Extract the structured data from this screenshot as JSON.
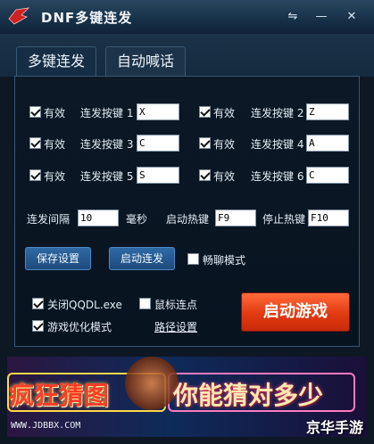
{
  "window": {
    "title": "DNF多键连发",
    "buttons": {
      "menu": "⇋",
      "minimize": "—",
      "close": "✕"
    }
  },
  "tabs": [
    {
      "label": "多键连发"
    },
    {
      "label": "自动喊话"
    }
  ],
  "keys": [
    {
      "enabled_label": "有效",
      "label": "连发按键 1",
      "value": "X"
    },
    {
      "enabled_label": "有效",
      "label": "连发按键 2",
      "value": "Z"
    },
    {
      "enabled_label": "有效",
      "label": "连发按键 3",
      "value": "C"
    },
    {
      "enabled_label": "有效",
      "label": "连发按键 4",
      "value": "A"
    },
    {
      "enabled_label": "有效",
      "label": "连发按键 5",
      "value": "S"
    },
    {
      "enabled_label": "有效",
      "label": "连发按键 6",
      "value": "C"
    }
  ],
  "interval": {
    "label": "连发间隔",
    "value": "10",
    "unit": "毫秒"
  },
  "hotkeys": {
    "start_label": "启动热键",
    "start_value": "F9",
    "stop_label": "停止热键",
    "stop_value": "F10"
  },
  "actions": {
    "save": "保存设置",
    "start": "启动连发",
    "chat_mode": "畅聊模式"
  },
  "options": {
    "close_qqdl": "关闭QQDL.exe",
    "mouse_click": "鼠标连点",
    "optimize": "游戏优化模式",
    "path": "路径设置"
  },
  "launch": "启动游戏",
  "banner": {
    "text1": "疯狂猜图",
    "text2": "你能猜对多少",
    "site": "WWW.JDBBX.COM",
    "brand": "京华手游"
  },
  "colors": {
    "accent": "#2f6aa6",
    "launch": "#e23a12"
  }
}
